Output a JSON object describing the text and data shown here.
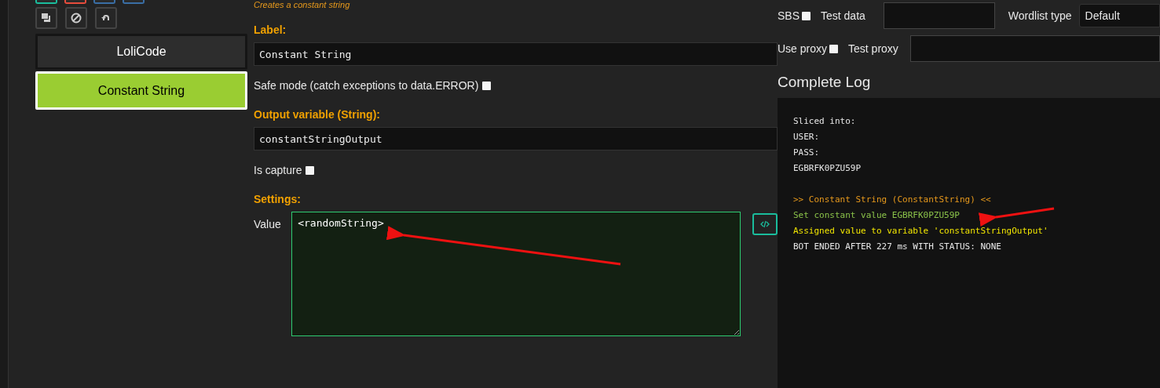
{
  "toolbar": {
    "top_buttons": [
      {
        "color": "#1abc9c"
      },
      {
        "color": "#e74c3c"
      },
      {
        "color": "#3a6ea5"
      },
      {
        "color": "#3a6ea5"
      }
    ],
    "icon_buttons": [
      {
        "kind": "clone"
      },
      {
        "kind": "disable"
      },
      {
        "kind": "undo"
      }
    ]
  },
  "blocks": [
    {
      "label": "LoliCode",
      "selected": false
    },
    {
      "label": "Constant String",
      "selected": true
    }
  ],
  "editor": {
    "description": "Creates a constant string",
    "label_heading": "Label:",
    "label_value": "Constant String",
    "safe_mode": {
      "text": "Safe mode (catch exceptions to data.ERROR)",
      "checked": false
    },
    "output_heading": "Output variable (String):",
    "output_value": "constantStringOutput",
    "is_capture": {
      "text": "Is capture",
      "checked": false
    },
    "settings_heading": "Settings:",
    "value_label": "Value",
    "value": "<randomString>"
  },
  "debugger": {
    "sbs": {
      "text": "SBS",
      "checked": false
    },
    "test_data_label": "Test data",
    "wordlist_label": "Wordlist type",
    "wordlist_value": "Default",
    "use_proxy": {
      "text": "Use proxy",
      "checked": false
    },
    "test_proxy_label": "Test proxy",
    "log_title": "Complete Log",
    "log": [
      {
        "text": "Sliced into:",
        "kind": "info"
      },
      {
        "text": "USER:",
        "kind": "info"
      },
      {
        "text": "PASS:",
        "kind": "info"
      },
      {
        "text": "EGBRFK0PZU59P",
        "kind": "info"
      },
      {
        "text": ">> Constant String (ConstantString) <<",
        "kind": "block"
      },
      {
        "text": "Set constant value EGBRFK0PZU59P",
        "kind": "success"
      },
      {
        "text": "Assigned value to variable 'constantStringOutput'",
        "kind": "variable"
      },
      {
        "text": "BOT ENDED AFTER 227 ms WITH STATUS: NONE",
        "kind": "info"
      }
    ]
  }
}
